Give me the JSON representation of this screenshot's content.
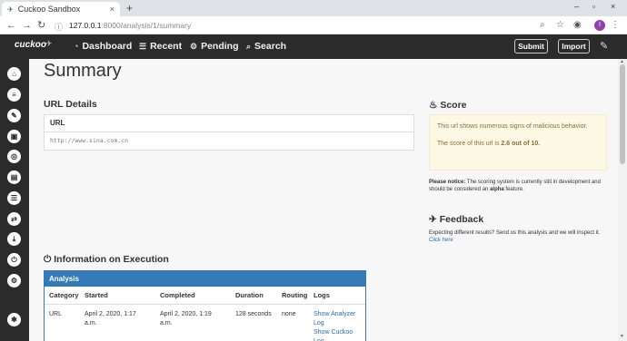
{
  "browser": {
    "tab_title": "Cuckoo Sandbox",
    "tab_favicon": "cuckoo-bird-icon",
    "url_host": "127.0.0.1",
    "url_path": ":8000/analysis/1/summary",
    "profile_initial": "I"
  },
  "navbar": {
    "brand": "cuckoo",
    "items": [
      {
        "label": "Dashboard",
        "icon": "dashboard-icon"
      },
      {
        "label": "Recent",
        "icon": "list-icon"
      },
      {
        "label": "Pending",
        "icon": "gears-icon"
      },
      {
        "label": "Search",
        "icon": "search-icon"
      }
    ],
    "submit_label": "Submit",
    "import_label": "Import"
  },
  "sidebar": {
    "icons": [
      "home-icon",
      "summary-icon",
      "static-icon",
      "file-icon",
      "network-icon",
      "behavior-icon",
      "list-icon",
      "shuffle-icon",
      "download-icon",
      "power-icon",
      "settings-icon",
      "bug-icon"
    ]
  },
  "page": {
    "title": "Summary",
    "url_details_title": "URL Details",
    "url_card_header": "URL",
    "url_value": "http://www.sina.com.cn"
  },
  "score": {
    "title": "Score",
    "message": "This url shows numerous signs of malicious behavior.",
    "score_prefix": "The score of this url is ",
    "score_value": "2.6 out of 10.",
    "notice_label": "Please notice:",
    "notice_text": " The scoring system is currently still in development and should be considered an ",
    "notice_alpha": "alpha",
    "notice_tail": " feature."
  },
  "feedback": {
    "title": "Feedback",
    "text": "Expecting different results? Send us this analysis and we will inspect it.",
    "link": "Click here"
  },
  "execution": {
    "title": "Information on Execution",
    "panel_header": "Analysis",
    "columns": [
      "Category",
      "Started",
      "Completed",
      "Duration",
      "Routing",
      "Logs"
    ],
    "row": {
      "category": "URL",
      "started": "April 2, 2020, 1:17 a.m.",
      "completed": "April 2, 2020, 1:19 a.m.",
      "duration": "128 seconds",
      "routing": "none",
      "log_analyzer": "Show Analyzer Log",
      "log_cuckoo": "Show Cuckoo Log"
    }
  },
  "colors": {
    "navbar": "#2b2b2b",
    "panel_primary": "#337ab7",
    "warning_bg": "#fcf8e3",
    "warning_text": "#8a6d3b"
  }
}
